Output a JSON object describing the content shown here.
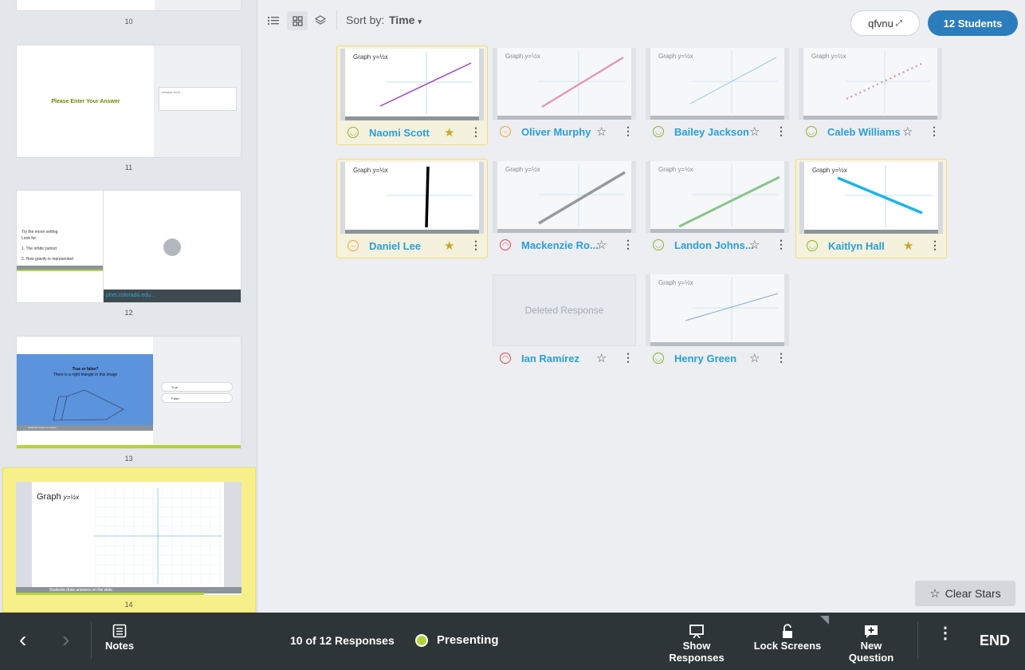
{
  "toolbar": {
    "sort_label": "Sort by:",
    "sort_value": "Time",
    "class_code": "qfvnu",
    "students_button": "12 Students"
  },
  "slides": [
    {
      "number": "10"
    },
    {
      "number": "11",
      "prompt": "Please Enter Your Answer",
      "answer_box": "Answer Here"
    },
    {
      "number": "12",
      "lines": [
        "Try the moon setting",
        "Look for:",
        "1. The orbits' period",
        "2. How gravity is represented"
      ],
      "link": "phet.colorado.edu..."
    },
    {
      "number": "13",
      "title": "True or false?",
      "subtitle": "There is a right triangle in this image",
      "options": [
        "True",
        "False"
      ],
      "footer": "Students choose an option"
    },
    {
      "number": "14",
      "title": "Graph",
      "equation": "y=½x",
      "footer": "Students draw answers on the slide"
    }
  ],
  "responses": [
    {
      "name": "Naomi Scott",
      "mood": "happy",
      "starred": true,
      "graph_title": "Graph y=½x",
      "line_color": "#9b3fc0"
    },
    {
      "name": "Oliver Murphy",
      "mood": "neutral",
      "starred": false,
      "graph_title": "Graph y=½x",
      "line_color": "#e0497a"
    },
    {
      "name": "Bailey Jackson",
      "mood": "happy",
      "starred": false,
      "graph_title": "Graph y=½x",
      "line_color": "#4fb0e8"
    },
    {
      "name": "Caleb Williams",
      "mood": "happy",
      "starred": false,
      "graph_title": "Graph y=½x",
      "line_color": "#d0455f"
    },
    {
      "name": "Daniel Lee",
      "mood": "neutral",
      "starred": true,
      "graph_title": "Graph y=½x",
      "line_color": "#000000"
    },
    {
      "name": "Mackenzie Ro...",
      "mood": "sad",
      "starred": false,
      "graph_title": "Graph y=½x",
      "line_color": "#555555"
    },
    {
      "name": "Landon Johns...",
      "mood": "happy",
      "starred": false,
      "graph_title": "Graph y=½x",
      "line_color": "#3aa53a"
    },
    {
      "name": "Kaitlyn Hall",
      "mood": "happy",
      "starred": true,
      "graph_title": "Graph y=½x",
      "line_color": "#1fb4e3"
    },
    {
      "name": "Ian Ramírez",
      "mood": "sad",
      "starred": false,
      "deleted_label": "Deleted Response"
    },
    {
      "name": "Henry Green",
      "mood": "happy",
      "starred": false,
      "graph_title": "Graph y=½x",
      "line_color": "#2f6fd0"
    }
  ],
  "clear_stars": "Clear Stars",
  "bottom": {
    "notes": "Notes",
    "response_count": "10 of 12 Responses",
    "presenting": "Presenting",
    "show_responses": "Show Responses",
    "lock_screens": "Lock Screens",
    "new_question": "New Question",
    "end": "END"
  },
  "colors": {
    "accent_blue": "#2b7dbc",
    "name_blue": "#2a9fd8",
    "highlight_yellow": "#f7f08a",
    "presenting_dot": "#b4d23a",
    "bottom_bar": "#2e3538"
  }
}
